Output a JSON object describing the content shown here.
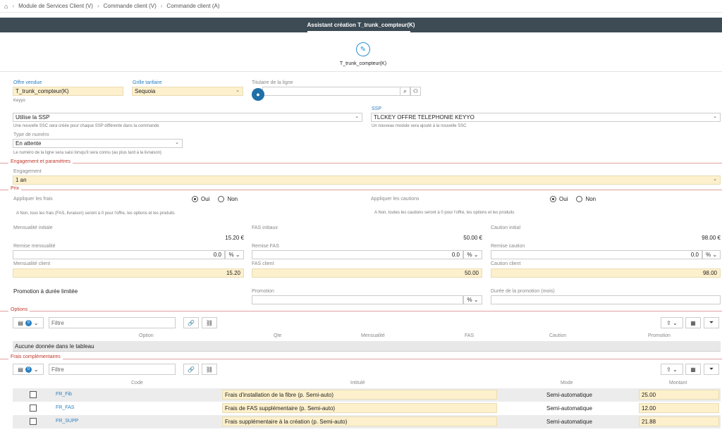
{
  "breadcrumb": {
    "home_icon": "home-icon",
    "items": [
      "Module de Services Client (V)",
      "Commande client (V)",
      "Commande client (A)"
    ]
  },
  "header": {
    "title": "Assistant création T_trunk_compteur(K)"
  },
  "step": {
    "icon": "pencil-icon",
    "label": "T_trunk_compteur(K)"
  },
  "form": {
    "offre_label": "Offre vendue",
    "offre_value": "T_trunk_compteur(K)",
    "offre_hint": "Keyyo",
    "grille_label": "Grille tarifaire",
    "grille_value": "Sequoia",
    "titulaire_label": "Titulaire de la ligne",
    "ssp_option": "Utilise la SSP",
    "ssp_option_hint": "Une nouvelle SSC sera créée pour chaque SSP différente dans la commande",
    "ssp_label": "SSP",
    "ssp_value": "TLCKEY OFFRE TELEPHONIE KEYYO",
    "ssp_hint": "Un nouveau module sera ajouté à la nouvelle SSC",
    "type_label": "Type de numéro",
    "type_value": "En attente",
    "type_hint": "Le numéro de la ligne sera saisi lorsqu'il sera connu (au plus tard à la livraison)"
  },
  "engagement": {
    "section": "Engagement et paramètres",
    "label": "Engagement",
    "value": "1 an"
  },
  "prix": {
    "section": "Prix",
    "frais_label": "Appliquer les frais",
    "oui": "Oui",
    "non": "Non",
    "frais_hint": "A Non, tous les frais (FAS, livraison) seront à 0 pour l'offre, les options et les produits",
    "cautions_label": "Appliquer les cautions",
    "cautions_hint": "A Non, toutes les cautions seront à 0 pour l'offre, les options et les produits",
    "mens_init_label": "Mensualité initiale",
    "mens_init_value": "15.20 €",
    "fas_init_label": "FAS initiaux",
    "fas_init_value": "50.00 €",
    "caution_init_label": "Caution initial",
    "caution_init_value": "98.00 €",
    "remise_mens_label": "Remise mensualité",
    "remise_fas_label": "Remise FAS",
    "remise_caution_label": "Remise caution",
    "remise_value": "0.0",
    "remise_unit": "%",
    "mens_client_label": "Mensualité client",
    "mens_client_value": "15.20",
    "fas_client_label": "FAS client",
    "fas_client_value": "50.00",
    "caution_client_label": "Caution client",
    "caution_client_value": "98.00",
    "promo_title": "Promotion à durée limitée",
    "promo_label": "Promotion",
    "promo_unit": "%",
    "promo_duree_label": "Durée de la promotion (mois)"
  },
  "options": {
    "section": "Options",
    "count": "0",
    "filter_placeholder": "Filtre",
    "columns": [
      "Option",
      "Qte",
      "Mensualité",
      "FAS",
      "Caution",
      "Promotion"
    ],
    "empty": "Aucune donnée dans le tableau"
  },
  "frais": {
    "section": "Frais complémentaires",
    "count": "0",
    "filter_placeholder": "Filtre",
    "columns": [
      "Code",
      "Intitulé",
      "Mode",
      "Montant"
    ],
    "rows": [
      {
        "code": "FR_Fib",
        "intitule": "Frais d'installation de la fibre (p. Semi-auto)",
        "mode": "Semi-automatique",
        "montant": "25.00"
      },
      {
        "code": "FR_FAS",
        "intitule": "Frais de FAS supplémentaire (p. Semi-auto)",
        "mode": "Semi-automatique",
        "montant": "12.00"
      },
      {
        "code": "FR_SUPP",
        "intitule": "Frais supplémentaire à la création (p. Semi-auto)",
        "mode": "Semi-automatique",
        "montant": "21.88"
      }
    ]
  }
}
